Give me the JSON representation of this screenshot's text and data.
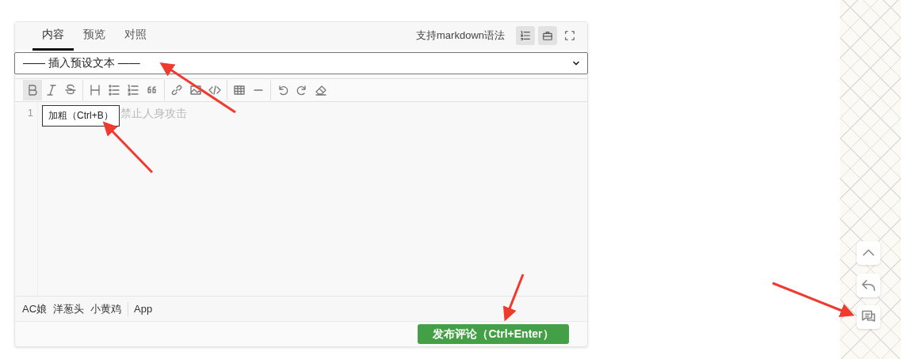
{
  "tabs": [
    {
      "label": "内容",
      "selected": true
    },
    {
      "label": "预览",
      "selected": false
    },
    {
      "label": "对照",
      "selected": false
    }
  ],
  "syntax_note": "支持markdown语法",
  "mode_buttons": [
    {
      "kind": "line-numbers",
      "on": true
    },
    {
      "kind": "toolbox",
      "on": true
    },
    {
      "kind": "fullscreen",
      "on": false
    }
  ],
  "preset_select": {
    "value": "—— 插入预设文本 ——"
  },
  "toolbar": [
    [
      {
        "kind": "bold",
        "selected": true
      },
      {
        "kind": "italic",
        "selected": false
      },
      {
        "kind": "strike",
        "selected": false
      }
    ],
    [
      {
        "kind": "heading",
        "selected": false
      },
      {
        "kind": "bullets",
        "selected": false
      },
      {
        "kind": "numbers",
        "selected": false
      },
      {
        "kind": "quote",
        "selected": false
      }
    ],
    [
      {
        "kind": "link",
        "selected": false
      },
      {
        "kind": "image",
        "selected": false
      },
      {
        "kind": "code",
        "selected": false
      }
    ],
    [
      {
        "kind": "table",
        "selected": false
      },
      {
        "kind": "rule",
        "selected": false
      }
    ],
    [
      {
        "kind": "undo",
        "selected": false
      },
      {
        "kind": "redo",
        "selected": false
      },
      {
        "kind": "eraser",
        "selected": false
      }
    ]
  ],
  "editor": {
    "line_number": "1",
    "placeholder": "禁止人身攻击"
  },
  "tooltip": "加粗（Ctrl+B）",
  "emoji_tabs": [
    {
      "label": "AC娘"
    },
    {
      "label": "洋葱头"
    },
    {
      "label": "小黄鸡"
    },
    {
      "label": "App"
    }
  ],
  "submit_button": "发布评论（Ctrl+Enter）",
  "side_buttons": [
    {
      "kind": "top"
    },
    {
      "kind": "reply"
    },
    {
      "kind": "comments"
    }
  ]
}
